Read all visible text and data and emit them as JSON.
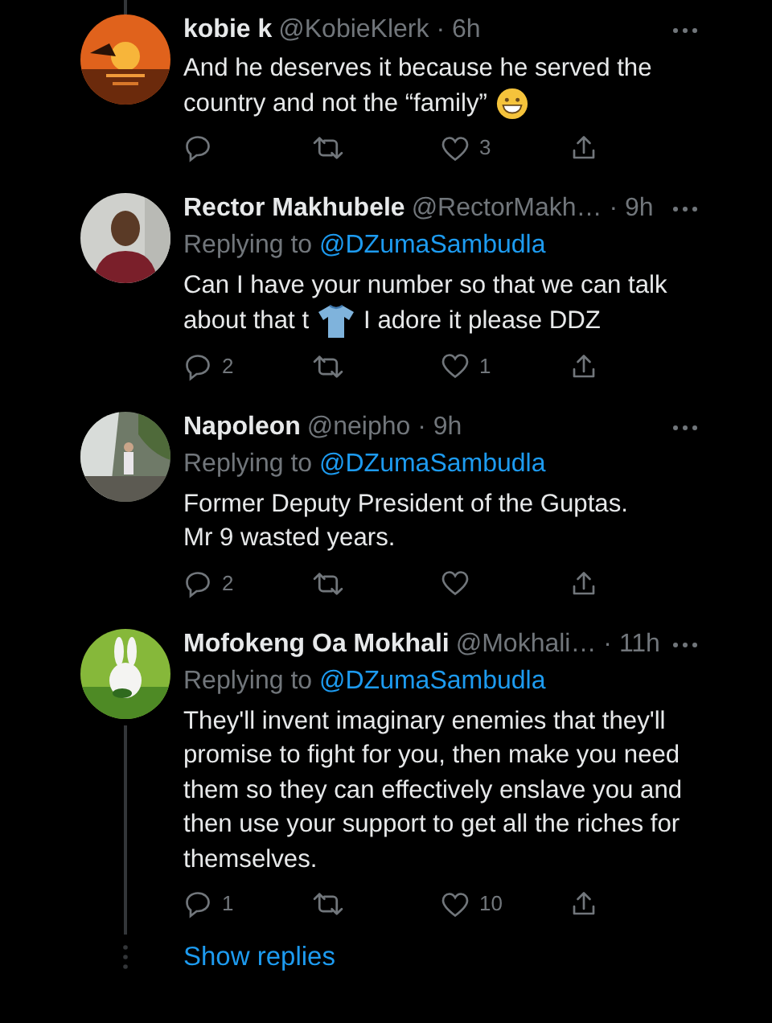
{
  "tweets": [
    {
      "name": "kobie k",
      "meta": "@KobieKlerk · 6h",
      "connected_above": true,
      "connected_below": false,
      "body": [
        [
          {
            "kind": "text",
            "text": "And he deserves it because he served the"
          }
        ],
        [
          {
            "kind": "text",
            "text": "country and not the “family”"
          },
          {
            "kind": "grin"
          }
        ]
      ],
      "actions": {
        "like_count": "3"
      }
    },
    {
      "name": "Rector Makhubele",
      "meta": "@RectorMakh… · 9h",
      "connected_above": false,
      "connected_below": false,
      "replying_label": "Replying to",
      "replying_to": "@DZumaSambudla",
      "body": [
        [
          {
            "kind": "text",
            "text": "Can I have your number so that we can talk"
          }
        ],
        [
          {
            "kind": "text",
            "text": "about that t"
          },
          {
            "kind": "shirt"
          },
          {
            "kind": "text",
            "text": "I adore it please DDZ"
          }
        ]
      ],
      "actions": {
        "reply_count": "2",
        "like_count": "1"
      }
    },
    {
      "name": "Napoleon",
      "meta": "@neipho · 9h",
      "connected_above": false,
      "connected_below": false,
      "replying_label": "Replying to",
      "replying_to": "@DZumaSambudla",
      "body": [
        [
          {
            "kind": "text",
            "text": "Former Deputy President of the Guptas."
          }
        ],
        [
          {
            "kind": "text",
            "text": "Mr 9 wasted years."
          }
        ]
      ],
      "actions": {
        "reply_count": "2"
      }
    },
    {
      "name": "Mofokeng Oa Mokhali",
      "meta": "@Mokhali… · 11h",
      "connected_above": false,
      "connected_below": true,
      "replying_label": "Replying to",
      "replying_to": "@DZumaSambudla",
      "body": [
        [
          {
            "kind": "text",
            "text": "They'll invent imaginary enemies that they'll promise to fight for you, then make you need them so they can effectively enslave you and then use your support to get all the riches for themselves."
          }
        ]
      ],
      "actions": {
        "reply_count": "1",
        "like_count": "10"
      }
    }
  ],
  "show_replies": "Show replies"
}
